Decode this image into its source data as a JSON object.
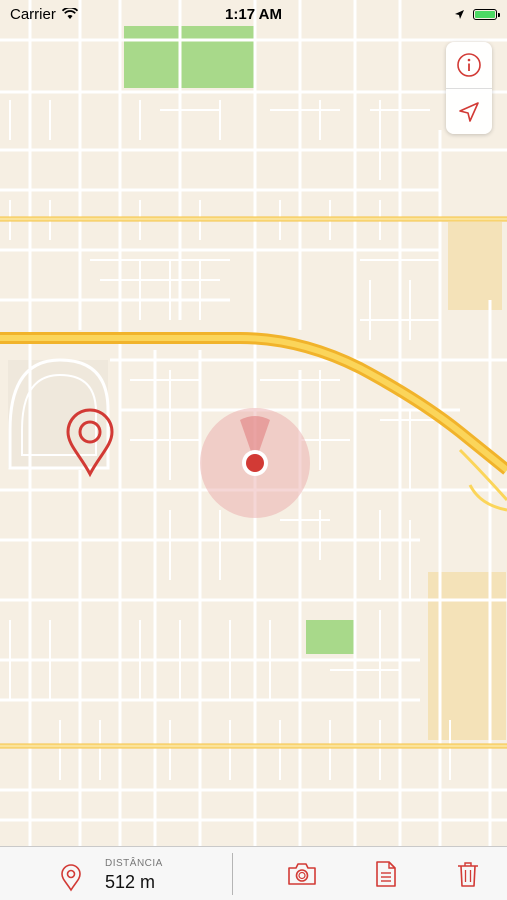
{
  "status_bar": {
    "carrier": "Carrier",
    "time": "1:17 AM",
    "battery_level": 1.0,
    "icons": [
      "wifi-icon",
      "location-arrow-icon",
      "battery-icon"
    ]
  },
  "map": {
    "type": "street-map",
    "map_controls": [
      "info-icon",
      "location-arrow-icon"
    ]
  },
  "bottom_bar": {
    "distance_label": "DISTÂNCIA",
    "distance_value": "512 m",
    "actions": [
      "camera-icon",
      "document-icon",
      "trash-icon"
    ]
  },
  "colors": {
    "accent": "#d23a35",
    "map_background": "#f6efe3",
    "highway": "#f5c341",
    "road": "#ffffff",
    "park": "#a8d98a",
    "commercial": "#f4e2b8",
    "accuracy_circle": "#e8a3a3"
  }
}
